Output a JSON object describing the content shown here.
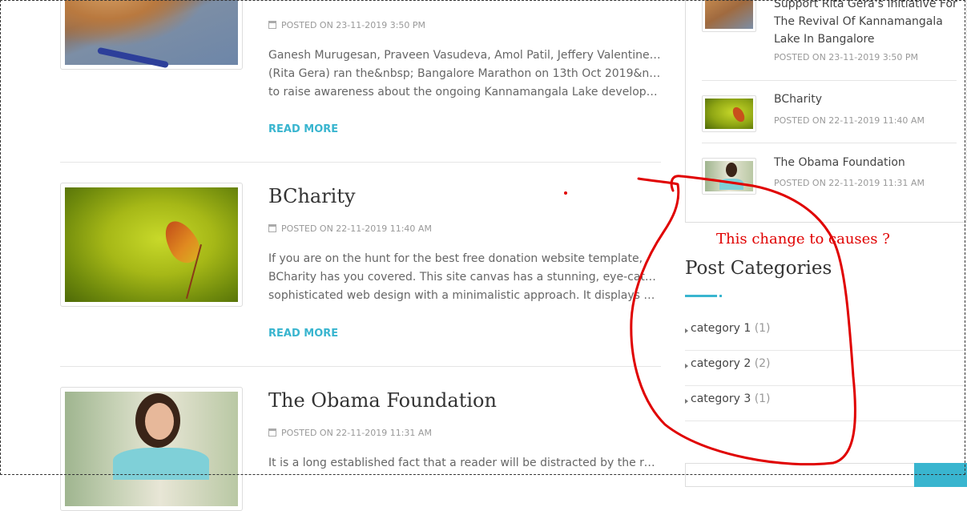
{
  "posts": [
    {
      "title": "",
      "date": "POSTED ON 23-11-2019 3:50 PM",
      "excerpt": [
        "Ganesh Murugesan, Praveen Vasudeva, Amol Patil, Jeffery Valentine and I",
        "(Rita Gera) ran the&nbsp; Bangalore Marathon on 13th Oct 2019&nbsp;",
        "to raise awareness about the ongoing Kannamangala Lake development…"
      ],
      "read_more": "READ MORE",
      "image": "dog-photo"
    },
    {
      "title": "BCharity",
      "date": "POSTED ON 22-11-2019 11:40 AM",
      "excerpt": [
        "If you are on the hunt for the best free donation website template,",
        "BCharity has you covered. This site canvas has a stunning, eye-catchy and",
        "sophisticated web design with a minimalistic approach. It displays all the…"
      ],
      "read_more": "READ MORE",
      "image": "leaf-photo"
    },
    {
      "title": "The Obama Foundation",
      "date": "POSTED ON 22-11-2019 11:31 AM",
      "excerpt": [
        "It is a long established fact that a reader will be distracted by the readable"
      ],
      "image": "woman-photo"
    }
  ],
  "sidebar": {
    "recent_posts": [
      {
        "title_lines": [
          "Support Rita Gera's Initiative For",
          "The Revival Of Kannamangala",
          "Lake In Bangalore"
        ],
        "date": "POSTED ON 23-11-2019 3:50 PM",
        "image": "dog-photo"
      },
      {
        "title_lines": [
          "BCharity"
        ],
        "date": "POSTED ON 22-11-2019 11:40 AM",
        "image": "leaf-photo"
      },
      {
        "title_lines": [
          "The Obama Foundation"
        ],
        "date": "POSTED ON 22-11-2019 11:31 AM",
        "image": "woman-photo"
      }
    ],
    "categories_title": "Post Categories",
    "categories": [
      {
        "name": "category 1",
        "count": "(1)"
      },
      {
        "name": "category 2",
        "count": "(2)"
      },
      {
        "name": "category 3",
        "count": "(1)"
      }
    ]
  },
  "annotation": {
    "text": "This change to causes ?",
    "color": "#e00000"
  },
  "colors": {
    "accent": "#39b5cf",
    "text": "#333333",
    "muted": "#999999"
  }
}
